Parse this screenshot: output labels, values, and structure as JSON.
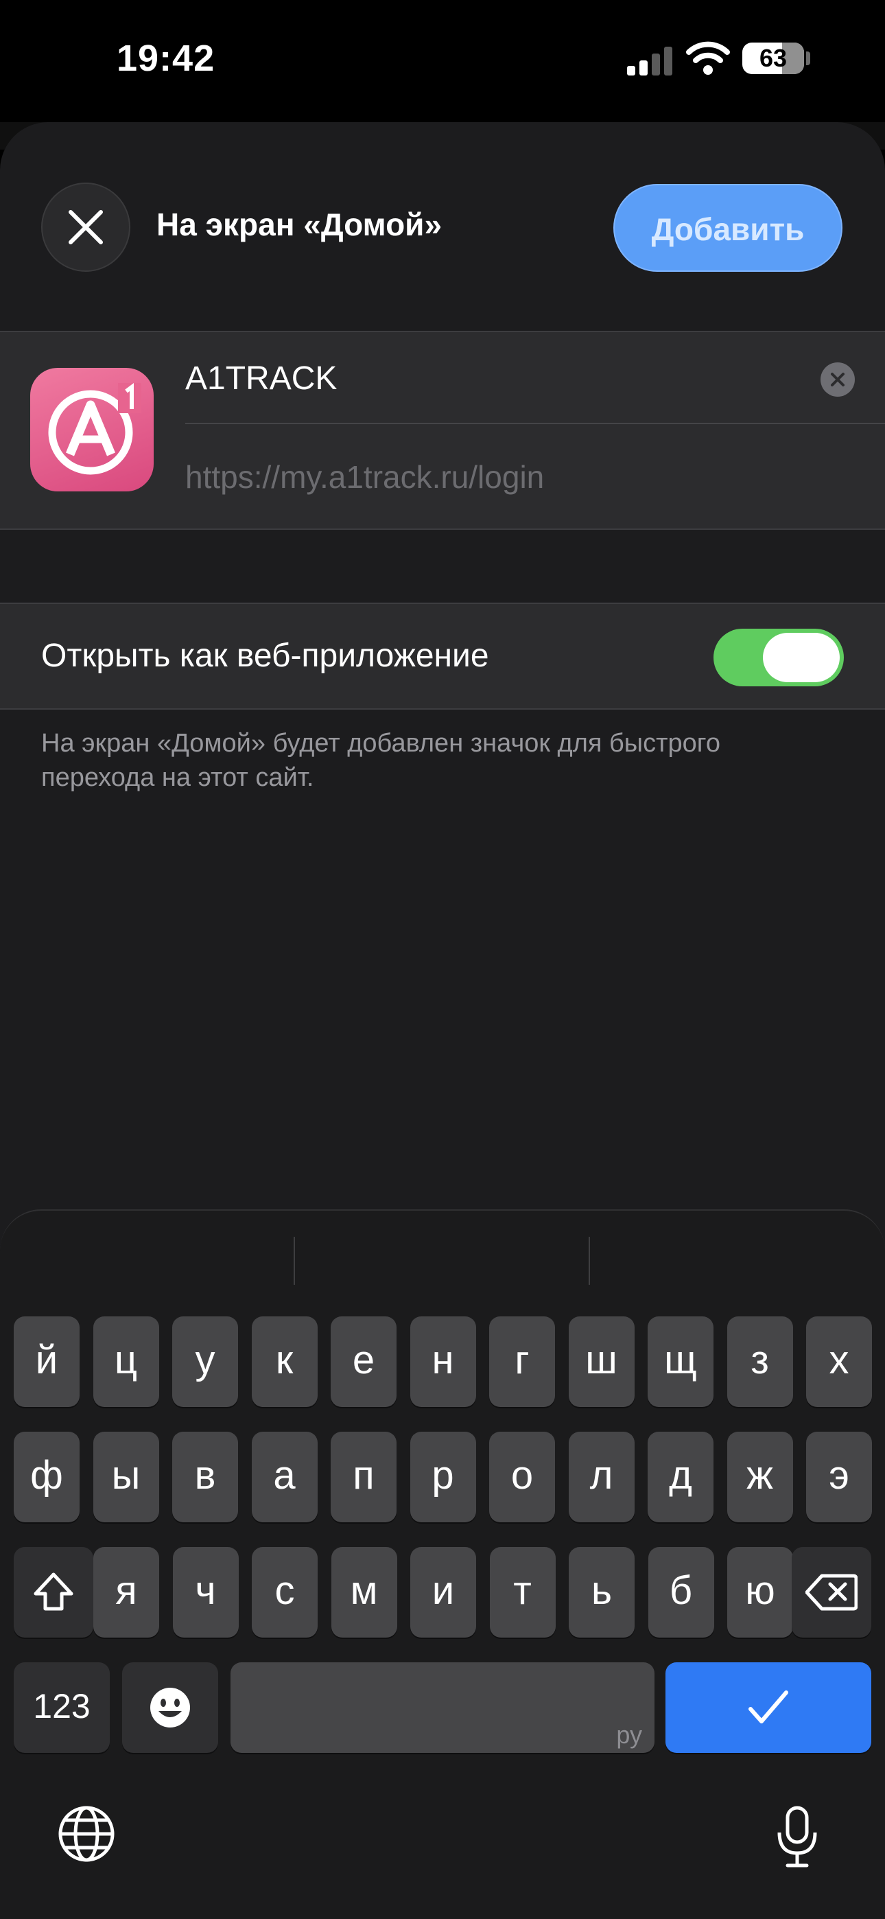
{
  "status_bar": {
    "time": "19:42",
    "battery": "63"
  },
  "header": {
    "title": "На экран «Домой»",
    "add_label": "Добавить"
  },
  "app": {
    "name": "A1TRACK",
    "url": "https://my.a1track.ru/login"
  },
  "web_app_toggle": {
    "label": "Открыть как веб-приложение",
    "on": true
  },
  "footer": {
    "text": "На экран «Домой» будет добавлен значок для быстрого перехода на этот сайт."
  },
  "keyboard": {
    "row1": [
      "й",
      "ц",
      "у",
      "к",
      "е",
      "н",
      "г",
      "ш",
      "щ",
      "з",
      "х"
    ],
    "row2": [
      "ф",
      "ы",
      "в",
      "а",
      "п",
      "р",
      "о",
      "л",
      "д",
      "ж",
      "э"
    ],
    "row3": [
      "я",
      "ч",
      "с",
      "м",
      "и",
      "т",
      "ь",
      "б",
      "ю"
    ],
    "numbers_label": "123",
    "space_lang": "ру",
    "done_label": "✓"
  },
  "colors": {
    "accent": "#5b9ef7",
    "toggle_on": "#5fcc5f",
    "done_key": "#2f7af4",
    "icon_pink": "#e0558a"
  }
}
